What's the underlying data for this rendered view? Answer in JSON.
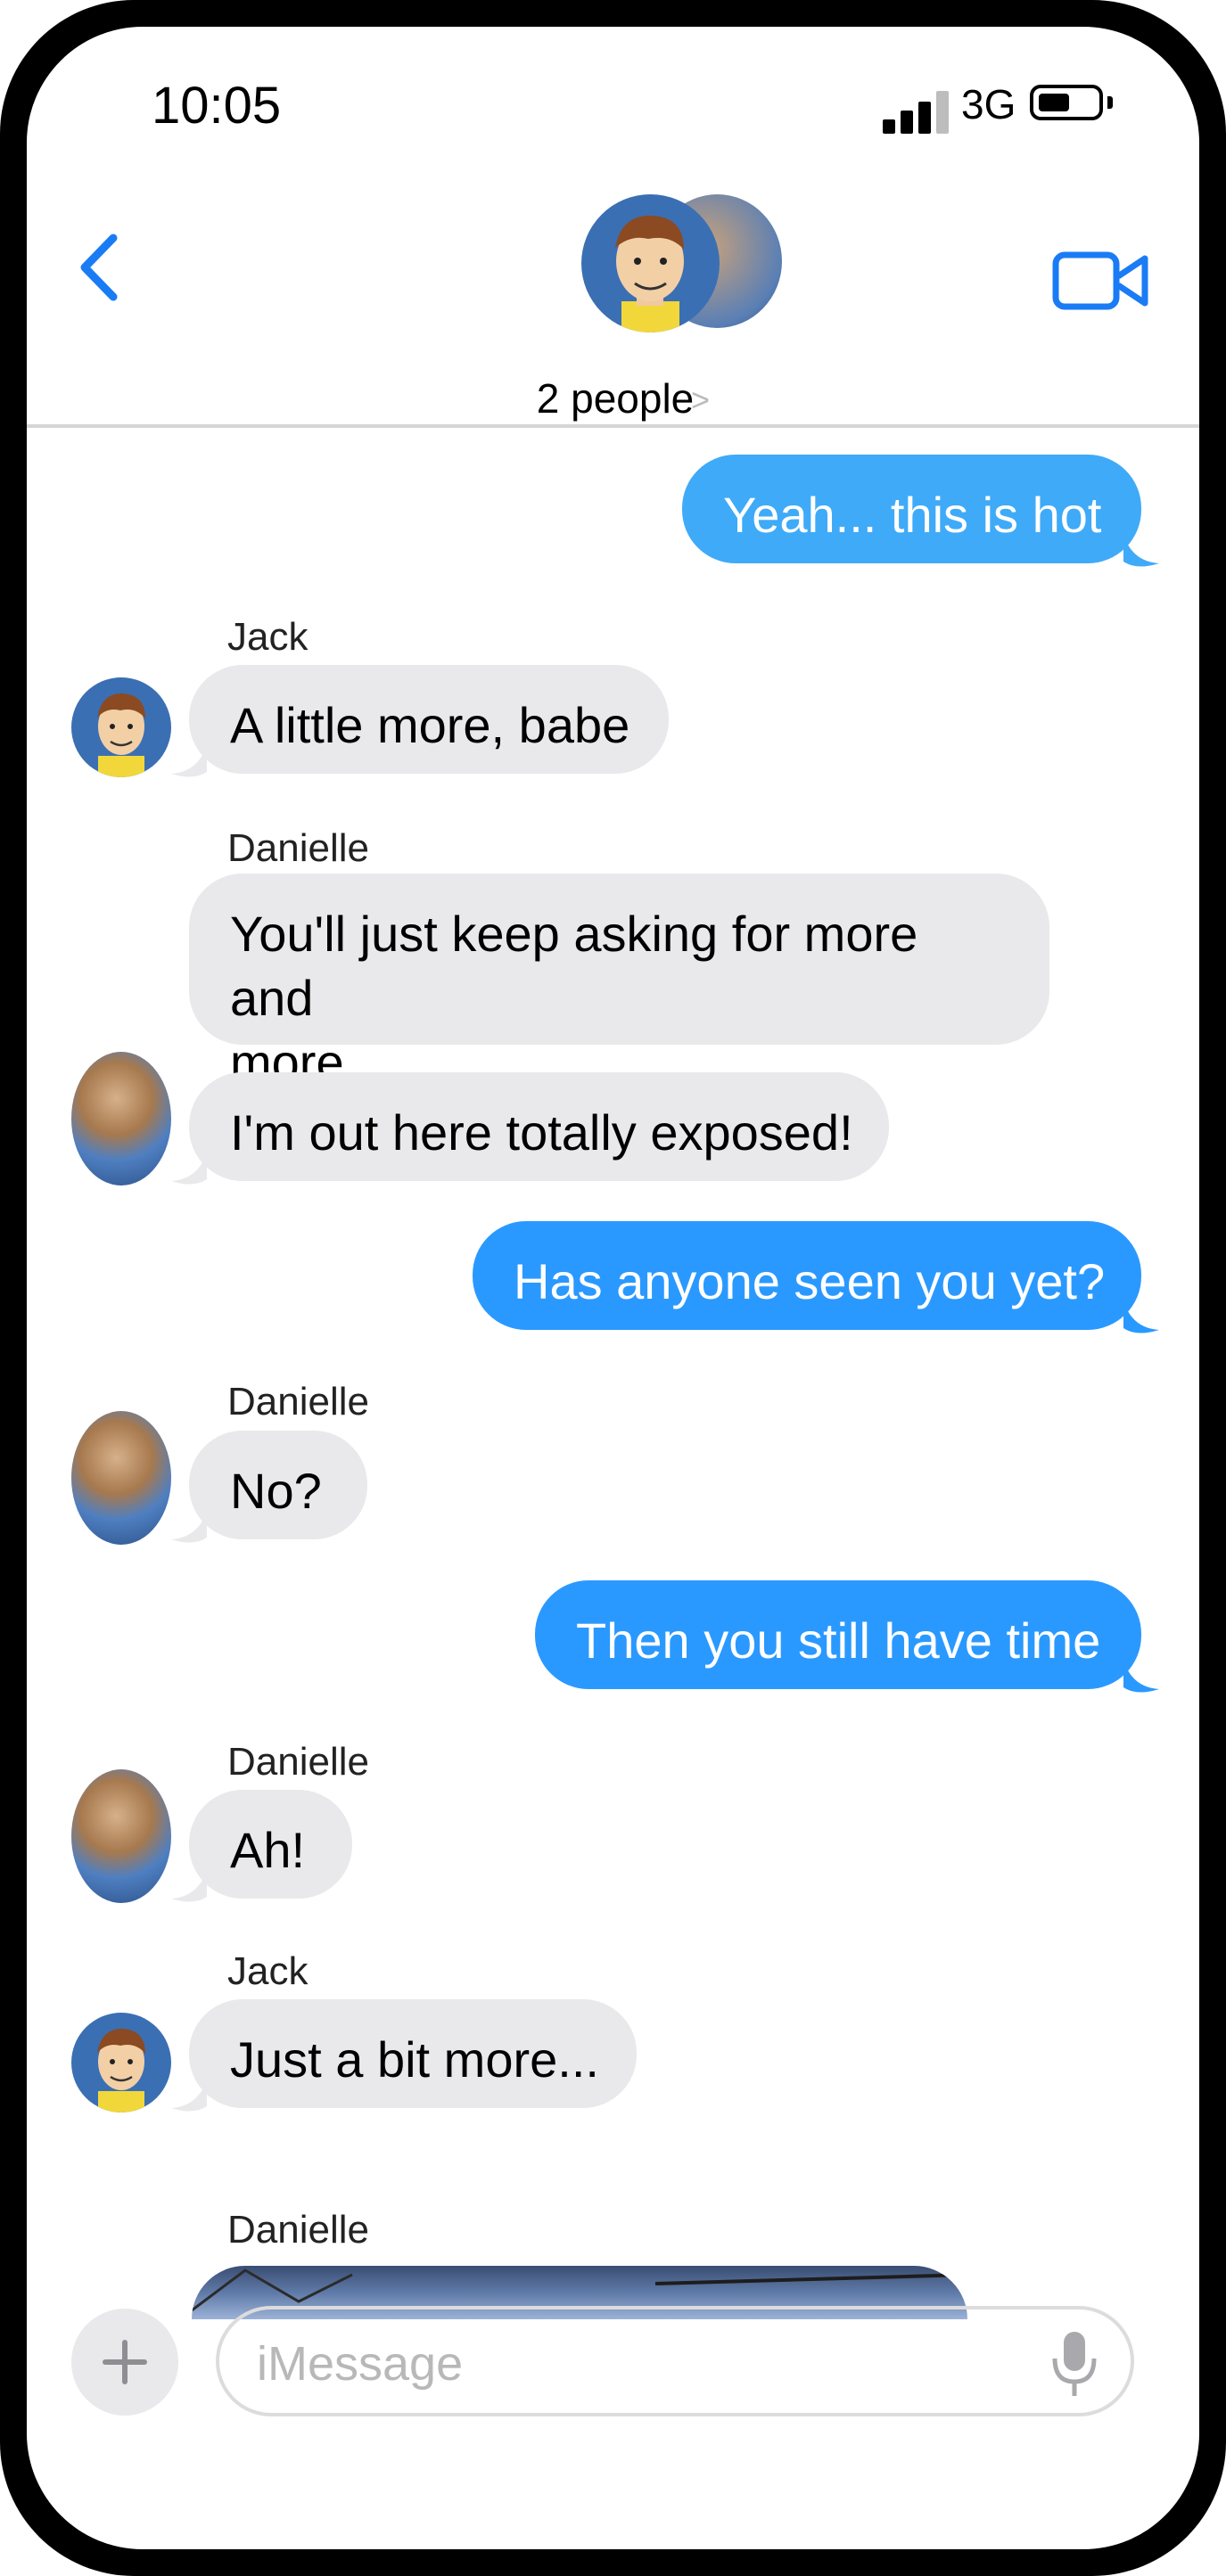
{
  "status_bar": {
    "time": "10:05",
    "network": "3G"
  },
  "header": {
    "group_name": "2 people",
    "chevron": ">"
  },
  "messages": [
    {
      "direction": "out",
      "text": "Yeah... this is hot"
    },
    {
      "direction": "in",
      "sender": "Jack",
      "text": "A little more, babe"
    },
    {
      "direction": "in",
      "sender": "Danielle",
      "text_lines": [
        "You'll just keep asking for more and",
        "more"
      ]
    },
    {
      "direction": "in",
      "text": "I'm out here totally exposed!"
    },
    {
      "direction": "out",
      "text": "Has anyone seen you yet?"
    },
    {
      "direction": "in",
      "sender": "Danielle",
      "text": "No?"
    },
    {
      "direction": "out",
      "text": "Then you still have time"
    },
    {
      "direction": "in",
      "sender": "Danielle",
      "text": "Ah!"
    },
    {
      "direction": "in",
      "sender": "Jack",
      "text": "Just a bit more..."
    },
    {
      "direction": "in",
      "sender": "Danielle",
      "attachment": "photo"
    }
  ],
  "composer": {
    "placeholder": "iMessage"
  },
  "colors": {
    "outgoing_bubble": "#2a99ff",
    "incoming_bubble": "#e9e9eb",
    "accent": "#1a7cf5"
  },
  "icons": {
    "back": "chevron-left-icon",
    "video": "video-camera-icon",
    "plus": "plus-icon",
    "mic": "microphone-icon"
  }
}
